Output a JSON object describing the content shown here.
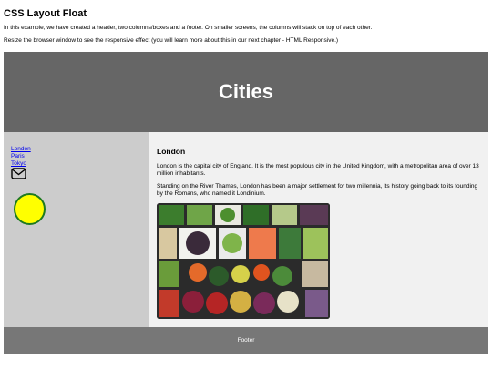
{
  "page": {
    "title": "CSS Layout Float",
    "intro_1": "In this example, we have created a header, two columns/boxes and a footer. On smaller screens, the columns will stack on top of each other.",
    "intro_2": "Resize the browser window to see the responsive effect (you will learn more about this in our next chapter - HTML Responsive.)"
  },
  "header": {
    "title": "Cities"
  },
  "nav": {
    "links": [
      "London",
      "Paris",
      "Tokyo"
    ],
    "icons": [
      "mail-icon",
      "yellow-circle"
    ]
  },
  "article": {
    "heading": "London",
    "paragraph_1": "London is the capital city of England. It is the most populous city in the United Kingdom, with a metropolitan area of over 13 million inhabitants.",
    "paragraph_2": "Standing on the River Thames, London has been a major settlement for two millennia, its history going back to its founding by the Romans, who named it Londinium.",
    "image": "vegetables-photo"
  },
  "footer": {
    "text": "Footer"
  },
  "colors": {
    "header_bg": "#666666",
    "nav_bg": "#cccccc",
    "article_bg": "#f1f1f1",
    "footer_bg": "#777777",
    "link": "#0000ee",
    "circle_fill": "#ffff00",
    "circle_stroke": "#1f7a1f"
  }
}
